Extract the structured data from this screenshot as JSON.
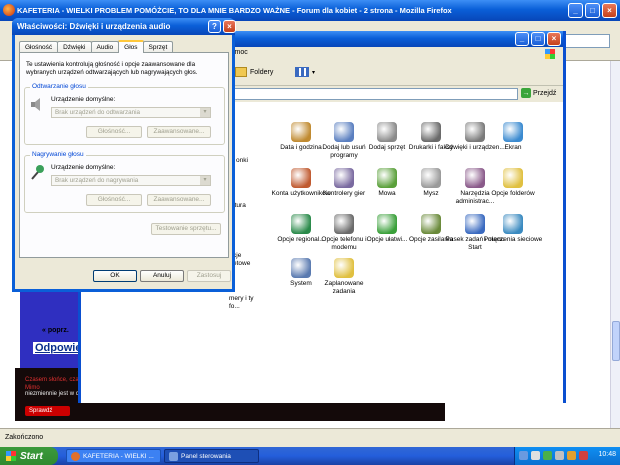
{
  "firefox": {
    "title": "KAFETERIA - WIELKI PROBLEM POMÓŻCIE, TO DLA MNIE BARDZO WAŻNE - Forum dla kobiet - 2 strona - Mozilla Firefox",
    "status": "Zakończono",
    "forum_prev": "« poprz.",
    "forum_reply": "Odpowied",
    "forum_banner_red": "Czasem słońce, czasem deszcz. W maju pogoda niepewna, ale na szczęście są prognozy. Mimo ",
    "forum_banner_white": "niezmiennie jest w czołówce rankingów gazety Forbes.",
    "forum_banner_button": "Sprawdź"
  },
  "control_panel": {
    "menu_fragment": "Pomoc",
    "toolbar_folders": "Foldery",
    "go_label": "Przejdź",
    "icons": [
      {
        "label": "Data i godzina",
        "color": "#c08a30"
      },
      {
        "label": "Dodaj lub usuń programy",
        "color": "#5a7fc0"
      },
      {
        "label": "Dodaj sprzęt",
        "color": "#8a8a8a"
      },
      {
        "label": "Drukarki i faksy",
        "color": "#6a6a6a"
      },
      {
        "label": "Dźwięki i urządzen...",
        "color": "#7a7a7a"
      },
      {
        "label": "Ekran",
        "color": "#3a8ad0"
      },
      {
        "label": "Konta użytkowników",
        "color": "#c05a30"
      },
      {
        "label": "Kontrolery gier",
        "color": "#7a6aa0"
      },
      {
        "label": "Mowa",
        "color": "#5aa03a"
      },
      {
        "label": "Mysz",
        "color": "#9a9a9a"
      },
      {
        "label": "Narzędzia administrac...",
        "color": "#8a5a8a"
      },
      {
        "label": "Opcje folderów",
        "color": "#e0c040"
      },
      {
        "label": "Opcje regional...",
        "color": "#2a8a4a"
      },
      {
        "label": "Opcje telefonu i modemu",
        "color": "#6a6a6a"
      },
      {
        "label": "Opcje ułatwi...",
        "color": "#3aa03a"
      },
      {
        "label": "Opcje zasilania",
        "color": "#6a8a3a"
      },
      {
        "label": "Pasek zadań i menu Start",
        "color": "#3a6ac0"
      },
      {
        "label": "Połączenia sieciowe",
        "color": "#3a8ac0"
      },
      {
        "label": "System",
        "color": "#5a7ab0"
      },
      {
        "label": "Zaplanowane zadania",
        "color": "#e0c040"
      }
    ],
    "left_fragments": [
      "onki",
      "atura",
      "cje etowe",
      "mery i ty fo..."
    ]
  },
  "dialog": {
    "title": "Właściwości: Dźwięki i urządzenia audio",
    "tabs": [
      "Głośność",
      "Dźwięki",
      "Audio",
      "Głos",
      "Sprzęt"
    ],
    "active_tab": "Głos",
    "description": "Te ustawienia kontrolują głośność i opcje zaawansowane dla wybranych urządzeń odtwarzających lub nagrywających głos.",
    "playback": {
      "label": "Odtwarzanie głosu",
      "device_label": "Urządzenie domyślne:",
      "device_value": "Brak urządzeń do odtwarzania",
      "volume_button": "Głośność...",
      "advanced_button": "Zaawansowane..."
    },
    "recording": {
      "label": "Nagrywanie głosu",
      "device_label": "Urządzenie domyślne:",
      "device_value": "Brak urządzeń do nagrywania",
      "volume_button": "Głośność...",
      "advanced_button": "Zaawansowane..."
    },
    "test_button": "Testowanie sprzętu...",
    "ok": "OK",
    "cancel": "Anuluj",
    "apply": "Zastosuj"
  },
  "taskbar": {
    "start": "Start",
    "tasks": [
      "KAFETERIA - WIELKI ...",
      "Panel sterowania"
    ],
    "clock": "10:48"
  }
}
